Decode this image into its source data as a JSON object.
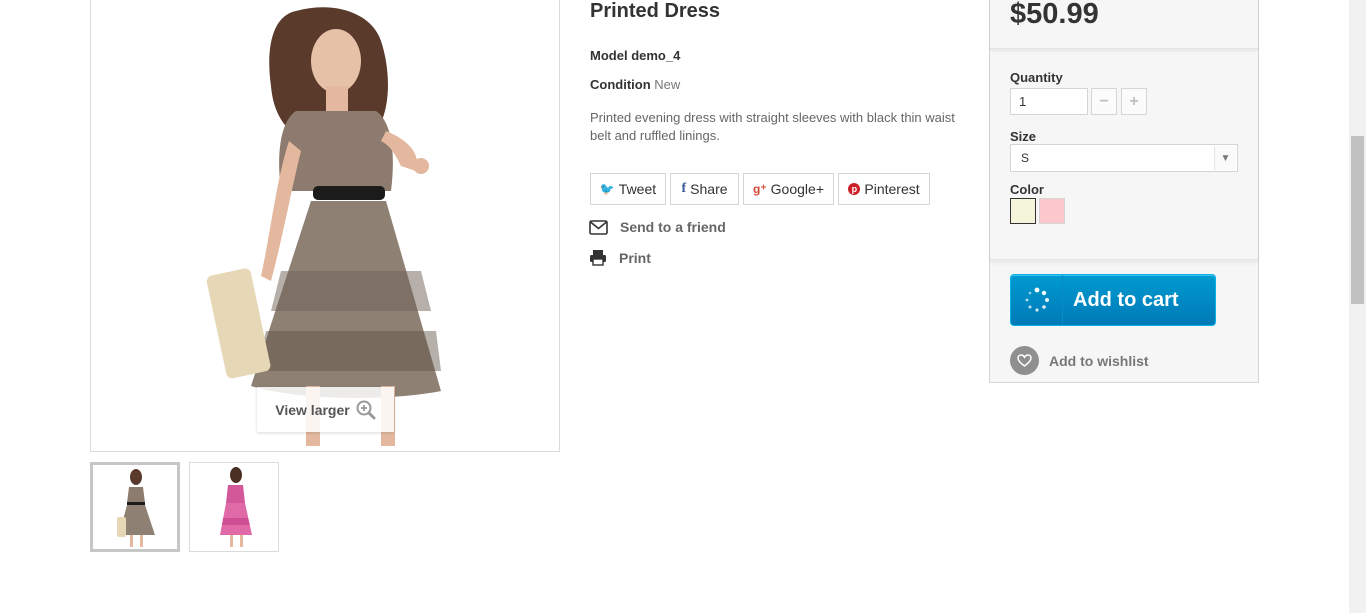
{
  "product": {
    "title": "Printed Dress",
    "model_label": "Model",
    "model_value": "demo_4",
    "condition_label": "Condition",
    "condition_value": "New",
    "description": "Printed evening dress with straight sleeves with black thin waist belt and ruffled linings."
  },
  "image": {
    "view_larger": "View larger"
  },
  "social": {
    "tweet": "Tweet",
    "share": "Share",
    "google": "Google+",
    "pinterest": "Pinterest"
  },
  "actions": {
    "send_to_friend": "Send to a friend",
    "print": "Print"
  },
  "buy": {
    "price": "$50.99",
    "quantity_label": "Quantity",
    "quantity_value": "1",
    "size_label": "Size",
    "size_selected": "S",
    "color_label": "Color",
    "colors": [
      "#f5f5dc",
      "#fcc8cd"
    ],
    "add_to_cart": "Add to cart",
    "add_to_wishlist": "Add to wishlist"
  },
  "colors": {
    "cart_button": "#0089c8"
  }
}
